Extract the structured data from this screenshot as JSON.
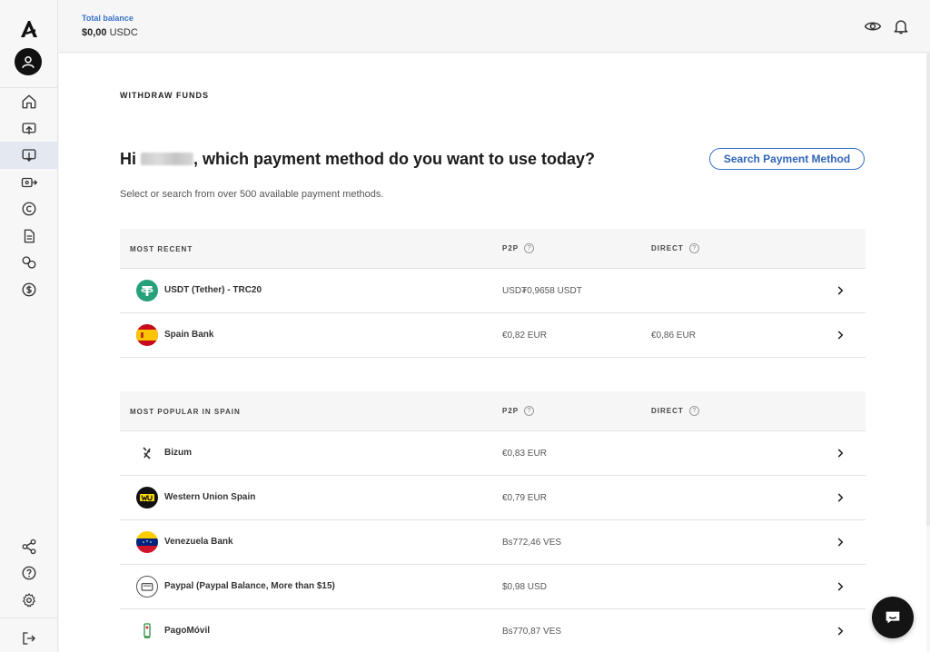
{
  "header": {
    "balance_label": "Total balance",
    "balance_amount": "$0,00",
    "balance_currency": "USDC"
  },
  "sidebar": {
    "items": [
      {
        "name": "home",
        "icon": "home-icon"
      },
      {
        "name": "deposit",
        "icon": "deposit-icon"
      },
      {
        "name": "withdraw",
        "icon": "withdraw-icon",
        "active": true
      },
      {
        "name": "transfer",
        "icon": "transfer-icon"
      },
      {
        "name": "copyright",
        "icon": "copyright-icon"
      },
      {
        "name": "documents",
        "icon": "document-icon"
      },
      {
        "name": "exchange",
        "icon": "exchange-icon"
      },
      {
        "name": "dollar",
        "icon": "dollar-icon"
      },
      {
        "name": "share",
        "icon": "share-icon"
      },
      {
        "name": "help",
        "icon": "help-icon"
      },
      {
        "name": "settings",
        "icon": "gear-icon"
      },
      {
        "name": "logout",
        "icon": "logout-icon"
      }
    ]
  },
  "page": {
    "title": "WITHDRAW FUNDS",
    "greeting_prefix": "Hi",
    "greeting_suffix": ", which payment method do you want to use today?",
    "search_button": "Search Payment Method",
    "subtitle": "Select or search from over 500 available payment methods."
  },
  "recent": {
    "header": "MOST RECENT",
    "col_p2p": "P2P",
    "col_direct": "DIRECT",
    "rows": [
      {
        "name": "USDT (Tether) - TRC20",
        "p2p": "USD₮0,9658 USDT",
        "direct": "",
        "icon": "tether-icon"
      },
      {
        "name": "Spain Bank",
        "p2p": "€0,82 EUR",
        "direct": "€0,86 EUR",
        "icon": "spain-flag-icon"
      }
    ]
  },
  "popular": {
    "header": "MOST POPULAR IN SPAIN",
    "col_p2p": "P2P",
    "col_direct": "DIRECT",
    "rows": [
      {
        "name": "Bizum",
        "p2p": "€0,83 EUR",
        "direct": "",
        "icon": "bizum-icon"
      },
      {
        "name": "Western Union Spain",
        "p2p": "€0,79 EUR",
        "direct": "",
        "icon": "western-union-icon"
      },
      {
        "name": "Venezuela Bank",
        "p2p": "Bs772,46 VES",
        "direct": "",
        "icon": "venezuela-flag-icon"
      },
      {
        "name": "Paypal (Paypal Balance, More than $15)",
        "p2p": "$0,98 USD",
        "direct": "",
        "icon": "paypal-icon"
      },
      {
        "name": "PagoMóvil",
        "p2p": "Bs770,87 VES",
        "direct": "",
        "icon": "pagomovil-icon"
      }
    ]
  },
  "colors": {
    "accent": "#3a72c9",
    "active_nav": "#e3e8f1",
    "tether": "#26a17b"
  }
}
